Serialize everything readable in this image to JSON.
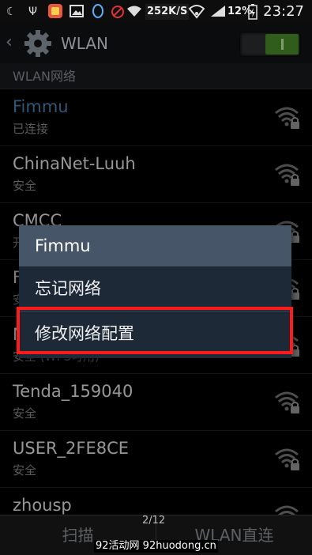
{
  "status_bar": {
    "speed": "252K/S",
    "battery": "12%",
    "time": "23:27",
    "icons": [
      "moon-icon",
      "usb-icon",
      "app-icon",
      "gallery-icon",
      "qq-icon",
      "headset-icon",
      "wifi-icon",
      "wifi-hotspot-icon",
      "signal-icon",
      "battery-charging-icon"
    ]
  },
  "app_bar": {
    "title": "WLAN",
    "toggle_state": "on",
    "accent": "#4a8f2a"
  },
  "section": {
    "label": "WLAN网络"
  },
  "networks": [
    {
      "ssid": "Fimmu",
      "status": "已连接",
      "connected": true
    },
    {
      "ssid": "ChinaNet-Luuh",
      "status": "安全",
      "connected": false
    },
    {
      "ssid": "CMCC",
      "status": "开",
      "connected": false
    },
    {
      "ssid": "F",
      "status": "安",
      "connected": false
    },
    {
      "ssid": "N",
      "status": "安全 (WPS可用)",
      "connected": false
    },
    {
      "ssid": "Tenda_159040",
      "status": "安全",
      "connected": false
    },
    {
      "ssid": "USER_2FE8CE",
      "status": "安全",
      "connected": false
    },
    {
      "ssid": "zhousp",
      "status": "",
      "connected": false
    }
  ],
  "dialog": {
    "title": "Fimmu",
    "items": [
      "忘记网络",
      "修改网络配置"
    ]
  },
  "bottom_bar": {
    "scan": "扫描",
    "direct": "WLAN直连",
    "pager": "2/12"
  },
  "watermark": "92活动网 92huodong.cn",
  "colors": {
    "highlight": "#ff1a1a",
    "connected_text": "#4a86b4",
    "dialog_title_bg": "#465668"
  }
}
